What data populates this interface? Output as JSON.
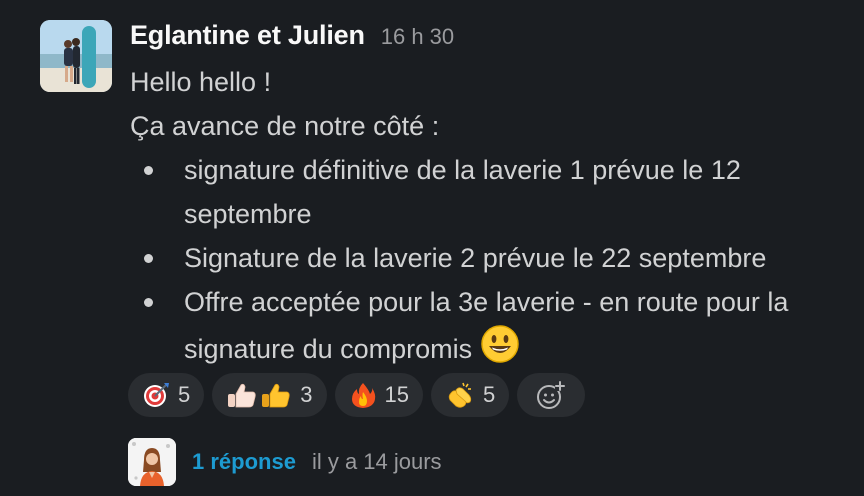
{
  "message": {
    "author": "Eglantine et Julien",
    "timestamp": "16 h 30",
    "lines": [
      "Hello hello !",
      "Ça avance de notre côté :"
    ],
    "bullets": [
      "signature définitive de la laverie 1 prévue le 12 septembre",
      "Signature de la laverie 2 prévue le 22 septembre",
      "Offre acceptée pour la 3e laverie - en route pour la signature du compromis"
    ],
    "inline_emoji": "smiley-emoji"
  },
  "reactions": [
    {
      "icon": "dart-icon",
      "count": "5"
    },
    {
      "icon": "thumbs-up-light-and-medium-icon",
      "count": "3"
    },
    {
      "icon": "fire-icon",
      "count": "15"
    },
    {
      "icon": "clapping-hands-icon",
      "count": "5"
    }
  ],
  "add_reaction_icon": "add-reaction-icon",
  "thread": {
    "reply_label": "1 réponse",
    "time_label": "il y a 14 jours"
  },
  "colors": {
    "background": "#1a1d21",
    "link": "#1d9bd1",
    "reaction_bg": "#2a2d31",
    "muted": "#9a9b9e"
  }
}
